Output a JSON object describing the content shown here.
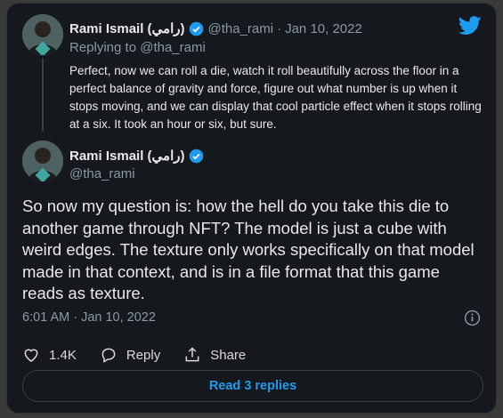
{
  "colors": {
    "accent": "#1d9bf0",
    "background": "#15181c",
    "muted": "#8b98a5",
    "text": "#e7e9ea"
  },
  "reply_tweet": {
    "author_name": "Rami Ismail (رامي)",
    "handle": "@tha_rami",
    "separator": "·",
    "date": "Jan 10, 2022",
    "replying_prefix": "Replying to",
    "replying_to": "@tha_rami",
    "text": "Perfect, now we can roll a die, watch it roll beautifully across the floor in a perfect balance of gravity and force, figure out what number is up when it stops moving, and we can display that cool particle effect when it stops rolling at a six. It took an hour or six, but sure."
  },
  "main_tweet": {
    "author_name": "Rami Ismail (رامي)",
    "handle": "@tha_rami",
    "text": "So now my question is: how the hell do you take this die to another game through NFT? The model is just a cube with weird edges. The texture only works specifically on that model made in that context, and is in a file format that this game reads as texture.",
    "timestamp": "6:01 AM · Jan 10, 2022",
    "likes": "1.4K",
    "reply_label": "Reply",
    "share_label": "Share",
    "read_replies_label": "Read 3 replies"
  },
  "icons": [
    "twitter-logo-icon",
    "verified-icon",
    "info-icon",
    "heart-icon",
    "reply-icon",
    "share-icon"
  ]
}
